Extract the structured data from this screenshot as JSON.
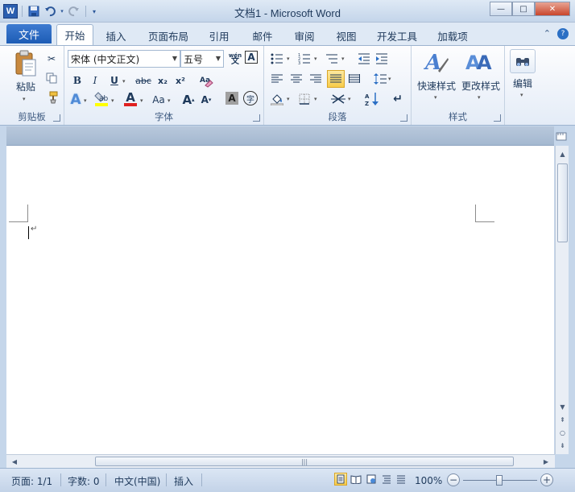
{
  "window": {
    "title": "文档1 - Microsoft Word",
    "app_icon": "W",
    "minimize": "—",
    "maximize": "□",
    "close": "✕"
  },
  "tabs": {
    "file": "文件",
    "items": [
      "开始",
      "插入",
      "页面布局",
      "引用",
      "邮件",
      "审阅",
      "视图",
      "开发工具",
      "加载项"
    ],
    "active_index": 0
  },
  "ribbon": {
    "clipboard": {
      "label": "剪贴板",
      "paste": "粘贴"
    },
    "font": {
      "label": "字体",
      "font_name": "宋体 (中文正文)",
      "font_size": "五号",
      "bold": "B",
      "italic": "I",
      "underline": "U",
      "strike": "abc",
      "subscript": "x₂",
      "superscript": "x²",
      "grow": "A",
      "shrink": "A",
      "change_case": "Aa",
      "shading": "A",
      "enclose": "字",
      "phonetic": "wén",
      "char_border": "A",
      "font_color": "A",
      "text_effect": "A"
    },
    "paragraph": {
      "label": "段落"
    },
    "styles": {
      "label": "样式",
      "quick_styles": "快速样式",
      "change_styles": "更改样式"
    },
    "editing": {
      "label": "编辑"
    }
  },
  "statusbar": {
    "page": "页面: 1/1",
    "words": "字数: 0",
    "language": "中文(中国)",
    "insert_mode": "插入",
    "zoom": "100%",
    "zoom_level": 1.0
  },
  "colors": {
    "accent": "#2b579a",
    "file_tab": "#1d5cb5",
    "highlight_yellow": "#ffff00",
    "font_red": "#e02020"
  }
}
